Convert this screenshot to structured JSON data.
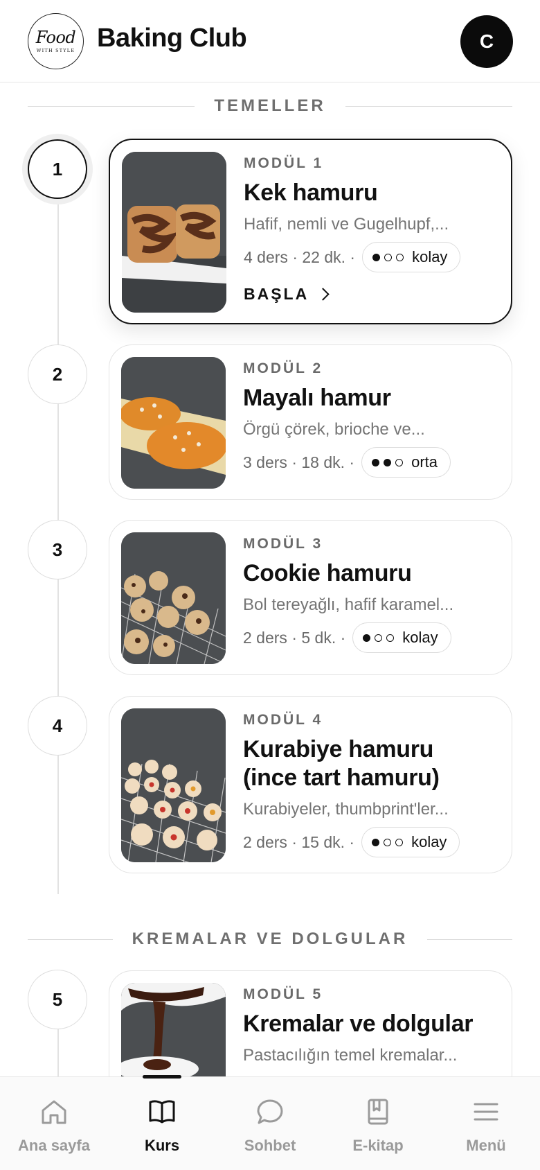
{
  "header": {
    "logo_script": "Food",
    "logo_small": "WITH STYLE",
    "title": "Baking Club",
    "avatar_initial": "C"
  },
  "sections": [
    {
      "label": "TEMELLER"
    },
    {
      "label": "KREMALAR VE DOLGULAR"
    }
  ],
  "modules": [
    {
      "step": "1",
      "kicker": "MODÜL 1",
      "title_line1": "Kek hamuru",
      "title_line2": "",
      "desc": "Hafif, nemli ve Gugelhupf,...",
      "meta": "4 ders · 22 dk. ·",
      "level": "kolay",
      "level_dots": 1,
      "cta": "BAŞLA",
      "active": true
    },
    {
      "step": "2",
      "kicker": "MODÜL 2",
      "title_line1": "Mayalı hamur",
      "title_line2": "",
      "desc": "Örgü çörek, brioche ve...",
      "meta": "3 ders · 18 dk. ·",
      "level": "orta",
      "level_dots": 2
    },
    {
      "step": "3",
      "kicker": "MODÜL 3",
      "title_line1": "Cookie hamuru",
      "title_line2": "",
      "desc": "Bol tereyağlı, hafif karamel...",
      "meta": "2 ders · 5 dk. ·",
      "level": "kolay",
      "level_dots": 1
    },
    {
      "step": "4",
      "kicker": "MODÜL 4",
      "title_line1": "Kurabiye hamuru",
      "title_line2": "(ince tart hamuru)",
      "desc": "Kurabiyeler, thumbprint'ler...",
      "meta": "2 ders · 15 dk. ·",
      "level": "kolay",
      "level_dots": 1
    },
    {
      "step": "5",
      "kicker": "MODÜL 5",
      "title_line1": "Kremalar ve dolgular",
      "title_line2": "",
      "desc": "Pastacılığın temel kremalar..."
    }
  ],
  "nav": {
    "items": [
      {
        "label": "Ana sayfa",
        "icon": "home-icon"
      },
      {
        "label": "Kurs",
        "icon": "book-icon",
        "active": true
      },
      {
        "label": "Sohbet",
        "icon": "chat-icon"
      },
      {
        "label": "E-kitap",
        "icon": "ebook-icon"
      },
      {
        "label": "Menü",
        "icon": "menu-icon"
      }
    ]
  },
  "colors": {
    "accent": "#111111",
    "muted": "#757575",
    "border": "#e3e3e3"
  }
}
